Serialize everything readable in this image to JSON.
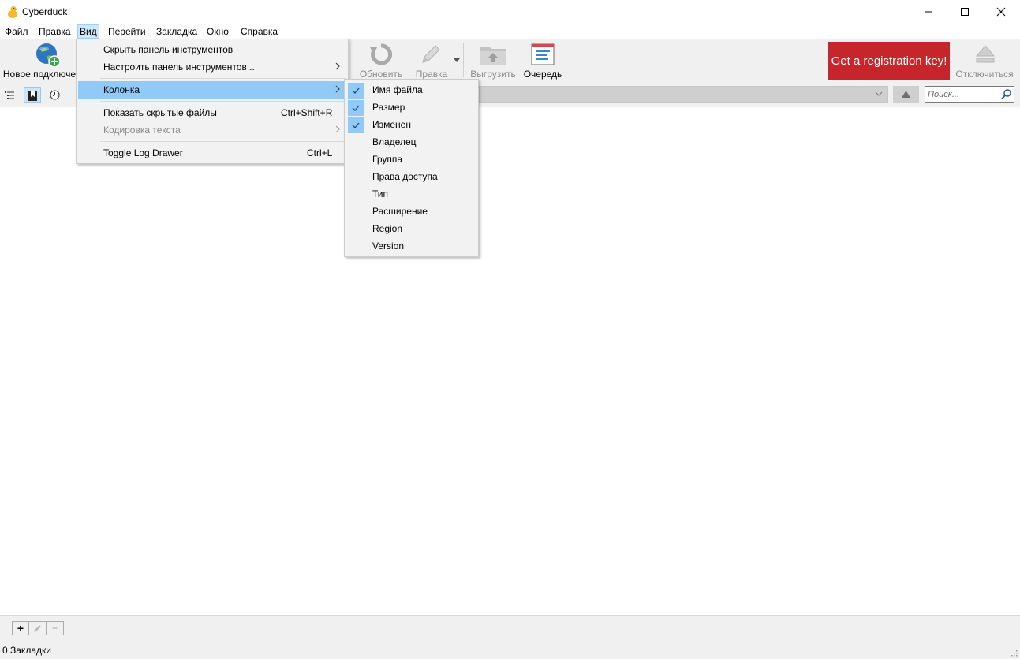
{
  "window": {
    "title": "Cyberduck"
  },
  "menubar": [
    "Файл",
    "Правка",
    "Вид",
    "Перейти",
    "Закладка",
    "Окно",
    "Справка"
  ],
  "toolbar": {
    "new_connection": "Новое подключе",
    "refresh": "Обновить",
    "edit": "Правка",
    "upload": "Выгрузить",
    "queue": "Очередь",
    "registration": "Get a registration key!",
    "disconnect": "Отключиться"
  },
  "search": {
    "placeholder": "Поиск..."
  },
  "view_menu": {
    "hide_toolbar": "Скрыть панель инструментов",
    "customize_toolbar": "Настроить панель инструментов...",
    "column": "Колонка",
    "show_hidden": "Показать скрытые файлы",
    "show_hidden_shortcut": "Ctrl+Shift+R",
    "encoding": "Кодировка текста",
    "toggle_log": "Toggle Log Drawer",
    "toggle_log_shortcut": "Ctrl+L"
  },
  "column_menu": {
    "items": [
      {
        "label": "Имя файла",
        "checked": true
      },
      {
        "label": "Размер",
        "checked": true
      },
      {
        "label": "Изменен",
        "checked": true
      },
      {
        "label": "Владелец",
        "checked": false
      },
      {
        "label": "Группа",
        "checked": false
      },
      {
        "label": "Права доступа",
        "checked": false
      },
      {
        "label": "Тип",
        "checked": false
      },
      {
        "label": "Расширение",
        "checked": false
      },
      {
        "label": "Region",
        "checked": false
      },
      {
        "label": "Version",
        "checked": false
      }
    ]
  },
  "bottom": {
    "add": "+",
    "remove": "−"
  },
  "status": {
    "text": "0 Закладки"
  },
  "colors": {
    "registration_bg": "#c6262b",
    "highlight": "#91c9f7",
    "menu_bg": "#f2f2f2"
  }
}
